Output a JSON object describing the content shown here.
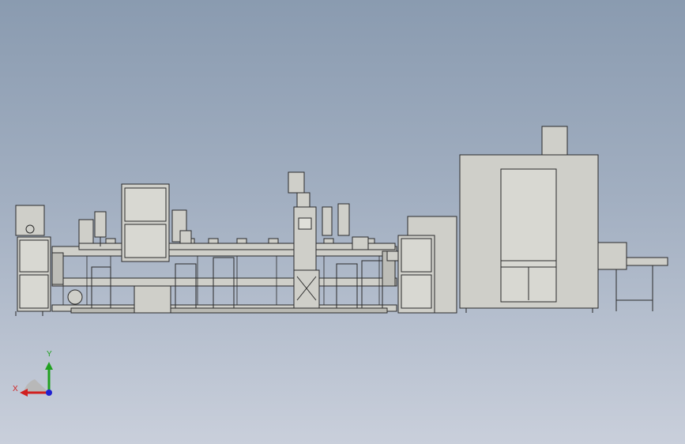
{
  "viewport": {
    "background_top": "#8a9bb0",
    "background_bottom": "#c9cfdb"
  },
  "model": {
    "fill_color": "#cfcfc9",
    "line_color": "#2a2a2a"
  },
  "triad": {
    "x_label": "X",
    "y_label": "Y",
    "x_color": "#d02020",
    "y_color": "#20a020",
    "z_color": "#2020d0"
  }
}
